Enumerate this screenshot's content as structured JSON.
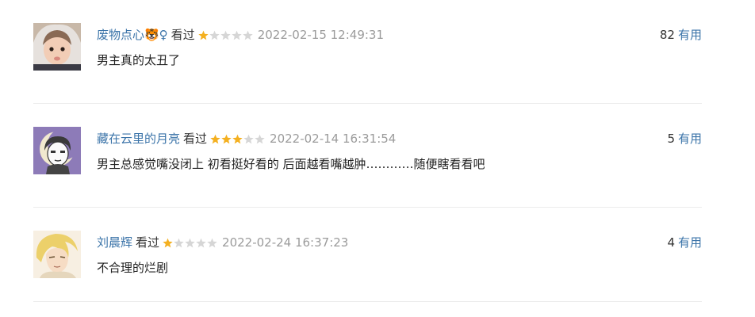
{
  "comments": [
    {
      "username": "废物点心🐯♀",
      "status": "看过",
      "rating": 1,
      "time": "2022-02-15 12:49:31",
      "votes": "82",
      "vote_label": "有用",
      "content": "男主真的太丑了"
    },
    {
      "username": "藏在云里的月亮",
      "status": "看过",
      "rating": 3,
      "time": "2022-02-14 16:31:54",
      "votes": "5",
      "vote_label": "有用",
      "content": "男主总感觉嘴没闭上 初看挺好看的 后面越看嘴越肿…………随便瞎看看吧"
    },
    {
      "username": "刘晨辉",
      "status": "看过",
      "rating": 1,
      "time": "2022-02-24 16:37:23",
      "votes": "4",
      "vote_label": "有用",
      "content": "不合理的烂剧"
    }
  ],
  "colors": {
    "username": "#3a73a8",
    "star_on": "#f4b020",
    "star_off": "#d6d6d6",
    "time": "#9b9b9b"
  }
}
